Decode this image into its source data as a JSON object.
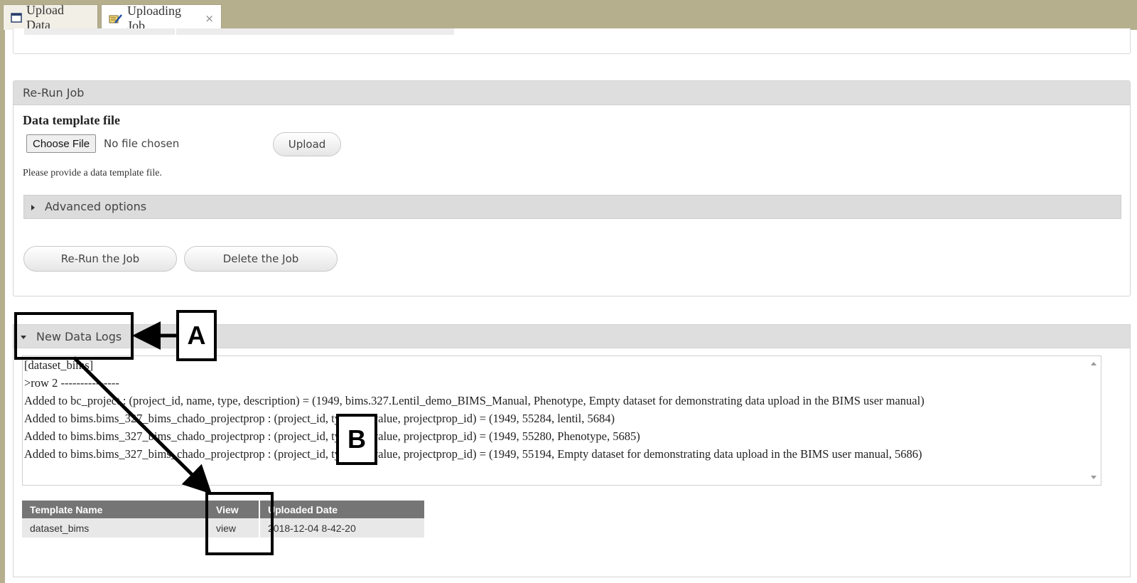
{
  "tabs": [
    {
      "label": "Upload Data",
      "icon": "window-icon"
    },
    {
      "label": "Uploading Job",
      "icon": "edit-doc-icon",
      "close": "×"
    }
  ],
  "rerun": {
    "title": "Re-Run Job",
    "template_label": "Data template file",
    "choose_file": "Choose File",
    "no_file": "No file chosen",
    "upload": "Upload",
    "hint": "Please provide a data template file.",
    "advanced": "Advanced options",
    "rerun_button": "Re-Run the Job",
    "delete_button": "Delete the Job"
  },
  "logs": {
    "title": "New Data Logs",
    "lines": [
      "[dataset_bims]",
      ">row 2 ---------------",
      "Added to bc_project : (project_id, name, type, description) = (1949, bims.327.Lentil_demo_BIMS_Manual, Phenotype, Empty dataset for demonstrating data upload in the BIMS user manual)",
      "Added to bims.bims_327_bims_chado_projectprop : (project_id, type_id, value, projectprop_id) = (1949, 55284, lentil, 5684)",
      "Added to bims.bims_327_bims_chado_projectprop : (project_id, type_id, value, projectprop_id) = (1949, 55280, Phenotype, 5685)",
      "Added to bims.bims_327_bims_chado_projectprop : (project_id, type_id, value, projectprop_id) = (1949, 55194, Empty dataset for demonstrating data upload in the BIMS user manual, 5686)"
    ]
  },
  "table": {
    "headers": [
      "Template Name",
      "View",
      "Uploaded Date"
    ],
    "rows": [
      [
        "dataset_bims",
        "view",
        "2018-12-04 8-42-20"
      ]
    ]
  },
  "annotations": {
    "a": "A",
    "b": "B"
  },
  "colors": {
    "tabbar": "#b5af8e",
    "header": "#dedede",
    "table_header": "#757575"
  }
}
